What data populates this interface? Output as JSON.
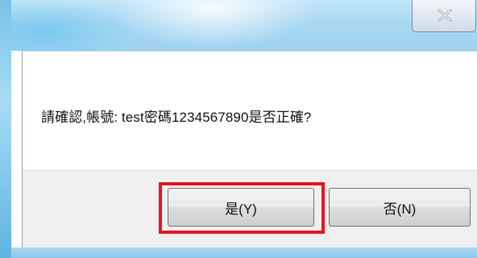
{
  "dialog": {
    "message": "請確認,帳號: test密碼1234567890是否正確?",
    "yes_label": "是(Y)",
    "no_label": "否(N)"
  },
  "titlebar": {
    "close_icon": "close-icon"
  },
  "colors": {
    "highlight_border": "#e8141b",
    "button_area_bg": "#f0f0f0"
  }
}
